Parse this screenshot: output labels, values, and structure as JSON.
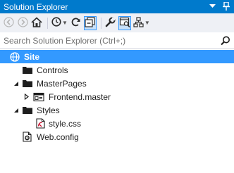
{
  "window": {
    "title": "Solution Explorer",
    "accent_color": "#007acc",
    "selection_color": "#3399ff"
  },
  "toolbar": {
    "buttons": [
      {
        "icon": "back-arrow-icon"
      },
      {
        "icon": "forward-arrow-icon"
      },
      {
        "icon": "home-icon"
      },
      {
        "icon": "history-clock-icon"
      },
      {
        "icon": "refresh-icon"
      },
      {
        "icon": "collapse-all-icon"
      },
      {
        "icon": "properties-wrench-icon"
      },
      {
        "icon": "preview-selected-icon"
      },
      {
        "icon": "class-diagram-icon"
      }
    ]
  },
  "search": {
    "placeholder": "Search Solution Explorer (Ctrl+;)"
  },
  "tree": [
    {
      "label": "Site",
      "icon": "globe-icon",
      "selected": true
    },
    {
      "label": "Controls",
      "icon": "folder-icon"
    },
    {
      "label": "MasterPages",
      "icon": "folder-icon",
      "expanded": true
    },
    {
      "label": "Frontend.master",
      "icon": "master-page-icon",
      "collapsed": true
    },
    {
      "label": "Styles",
      "icon": "folder-icon",
      "expanded": true
    },
    {
      "label": "style.css",
      "icon": "css-file-icon"
    },
    {
      "label": "Web.config",
      "icon": "config-file-icon"
    }
  ]
}
